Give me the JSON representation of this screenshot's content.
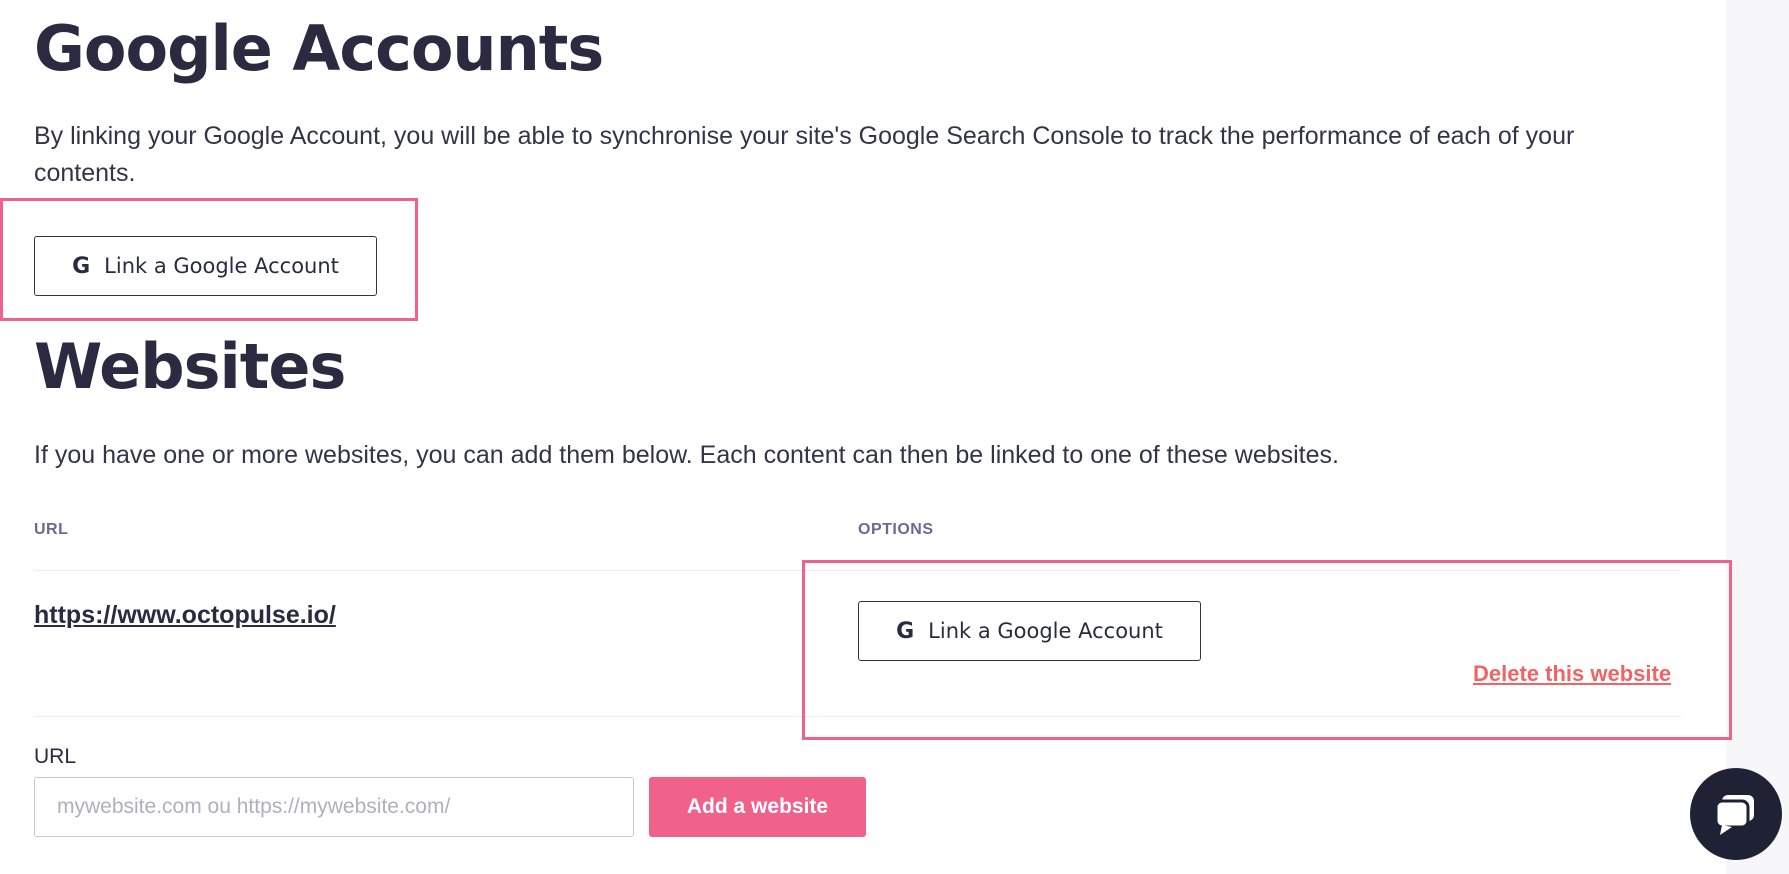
{
  "google_section": {
    "title": "Google Accounts",
    "description": "By linking your Google Account, you will be able to synchronise your site's Google Search Console to track the performance of each of your contents.",
    "link_button_label": "Link a Google Account",
    "link_button_icon": "google-g-icon"
  },
  "websites_section": {
    "title": "Websites",
    "description": "If you have one or more websites, you can add them below. Each content can then be linked to one of these websites.",
    "table": {
      "columns": [
        "URL",
        "OPTIONS"
      ],
      "rows": [
        {
          "url": "https://www.octopulse.io/",
          "link_button_label": "Link a Google Account",
          "delete_label": "Delete this website"
        }
      ]
    },
    "add_form": {
      "label": "URL",
      "placeholder": "mywebsite.com ou https://mywebsite.com/",
      "value": "",
      "submit_label": "Add a website"
    }
  },
  "chat_widget": {
    "icon": "chat-icon"
  },
  "colors": {
    "accent_pink": "#f0628c",
    "delete_red": "#ef6464",
    "text_dark": "#2b2a40",
    "header_muted": "#6b6894",
    "chat_bg": "#1f2235"
  }
}
